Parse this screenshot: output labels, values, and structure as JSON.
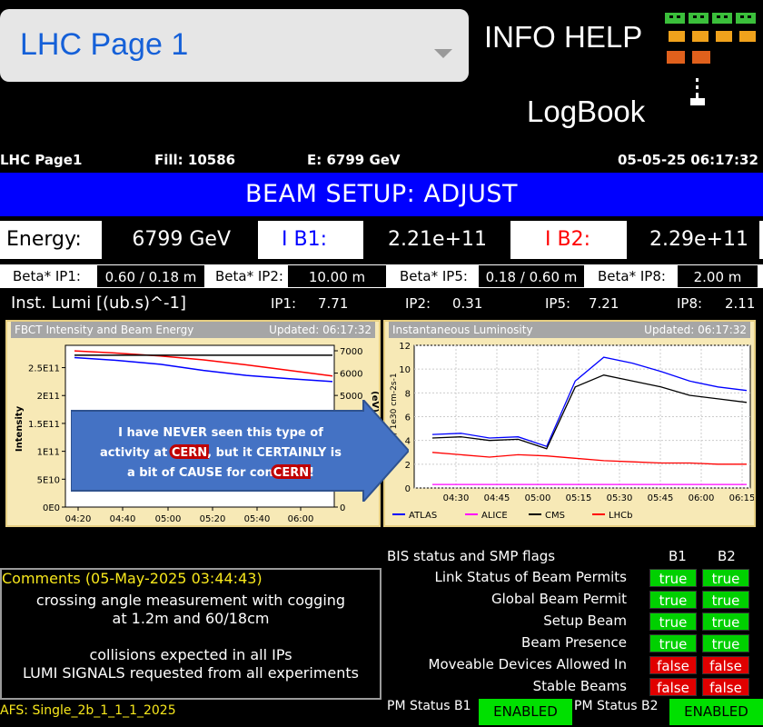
{
  "selector": {
    "label": "LHC Page 1"
  },
  "top_links": {
    "info_help": "INFO HELP",
    "logbook": "LogBook"
  },
  "status": {
    "page": "LHC Page1",
    "fill": "Fill: 10586",
    "energy": "E:  6799 GeV",
    "datetime": "05-05-25 06:17:32"
  },
  "banner": "BEAM SETUP: ADJUST",
  "energy_row": {
    "energy_label": "Energy:",
    "energy_value": "6799 GeV",
    "ib1_label": "I B1:",
    "ib1_value": "2.21e+11",
    "ib2_label": "I B2:",
    "ib2_value": "2.29e+11",
    "ib1_color": "#0000ff",
    "ib2_color": "#ff0000"
  },
  "beta": [
    {
      "label": "Beta* IP1:",
      "value": "0.60 / 0.18 m"
    },
    {
      "label": "Beta* IP2:",
      "value": "10.00 m"
    },
    {
      "label": "Beta* IP5:",
      "value": "0.18 / 0.60 m"
    },
    {
      "label": "Beta* IP8:",
      "value": "2.00 m"
    }
  ],
  "lumi": {
    "label": "Inst. Lumi [(ub.s)^-1]",
    "ip1": "IP1:",
    "ip1_v": "7.71",
    "ip2": "IP2:",
    "ip2_v": "0.31",
    "ip5": "IP5:",
    "ip5_v": "7.21",
    "ip8": "IP8:",
    "ip8_v": "2.11"
  },
  "left_panel": {
    "title": "FBCT Intensity and Beam Energy",
    "updated": "Updated: 06:17:32"
  },
  "right_panel": {
    "title": "Instantaneous Luminosity",
    "updated": "Updated: 06:17:32"
  },
  "chart_data": [
    {
      "type": "line",
      "title": "FBCT Intensity and Beam Energy",
      "ylabel": "Intensity",
      "y2label": "(eV)",
      "x": [
        "04:20",
        "04:40",
        "05:00",
        "05:20",
        "05:40",
        "06:00"
      ],
      "ylim": [
        0,
        290000000000.0
      ],
      "yticks": [
        "0E0",
        "5E10",
        "1E11",
        "1.5E11",
        "2E11",
        "2.5E11"
      ],
      "y2ticks": [
        "0",
        "1000",
        "2000",
        "3000",
        "4000",
        "5000",
        "6000",
        "7000"
      ],
      "series": [
        {
          "color": "#ff0000",
          "values": [
            280000000000.0,
            276000000000.0,
            271000000000.0,
            264000000000.0,
            255000000000.0,
            245000000000.0,
            235000000000.0
          ]
        },
        {
          "color": "#0000ff",
          "values": [
            268000000000.0,
            263000000000.0,
            256000000000.0,
            245000000000.0,
            236000000000.0,
            230000000000.0,
            225000000000.0
          ]
        },
        {
          "color": "#000000",
          "values": [
            6799,
            6799,
            6799,
            6799,
            6799,
            6799,
            6799
          ]
        }
      ]
    },
    {
      "type": "line",
      "title": "Instantaneous Luminosity",
      "ylabel": "Lu...y / 1e30 cm-2s-1",
      "x": [
        "04:30",
        "04:45",
        "05:00",
        "05:15",
        "05:30",
        "05:45",
        "06:00",
        "06:15"
      ],
      "ylim": [
        0,
        12
      ],
      "yticks": [
        "0",
        "2",
        "4",
        "6",
        "8",
        "10",
        "12"
      ],
      "legend": [
        "ATLAS",
        "ALICE",
        "CMS",
        "LHCb"
      ],
      "legend_colors": [
        "#0000ff",
        "#ff00ff",
        "#000000",
        "#ff0000"
      ],
      "series": [
        {
          "name": "ATLAS",
          "color": "#0000ff",
          "values": [
            4.5,
            4.6,
            4.2,
            4.3,
            3.5,
            9.0,
            11.0,
            10.5,
            9.8,
            9.0,
            8.5,
            8.2
          ]
        },
        {
          "name": "ALICE",
          "color": "#ff00ff",
          "values": [
            0.3,
            0.3,
            0.3,
            0.3,
            0.3,
            0.3,
            0.3,
            0.3,
            0.3,
            0.3,
            0.3,
            0.3
          ]
        },
        {
          "name": "CMS",
          "color": "#000000",
          "values": [
            4.2,
            4.3,
            4.0,
            4.1,
            3.3,
            8.5,
            9.5,
            9.0,
            8.5,
            7.8,
            7.5,
            7.2
          ]
        },
        {
          "name": "LHCb",
          "color": "#ff0000",
          "values": [
            3.0,
            2.8,
            2.6,
            2.8,
            2.7,
            2.5,
            2.3,
            2.2,
            2.1,
            2.1,
            2.0,
            2.0
          ]
        }
      ]
    }
  ],
  "callout": {
    "line1": "I have NEVER seen this type of",
    "line2a": "activity at ",
    "line2b": "CERN",
    "line2c": ", but it CERTAINLY is",
    "line3a": "a bit of CAUSE for con",
    "line3b": "CERN",
    "line3c": "!"
  },
  "comments": {
    "title": "Comments (05-May-2025 03:44:43)",
    "lines": [
      "crossing angle measurement with cogging",
      "at 1.2m and 60/18cm",
      "",
      "collisions expected in all IPs",
      "LUMI SIGNALS requested from all experiments"
    ]
  },
  "afs": "AFS: Single_2b_1_1_1_2025",
  "flags": {
    "title": "BIS status and SMP flags",
    "b1": "B1",
    "b2": "B2",
    "rows": [
      {
        "label": "Link Status of Beam Permits",
        "b1": "true",
        "b2": "true"
      },
      {
        "label": "Global Beam Permit",
        "b1": "true",
        "b2": "true"
      },
      {
        "label": "Setup Beam",
        "b1": "true",
        "b2": "true"
      },
      {
        "label": "Beam Presence",
        "b1": "true",
        "b2": "true"
      },
      {
        "label": "Moveable Devices Allowed In",
        "b1": "false",
        "b2": "false"
      },
      {
        "label": "Stable Beams",
        "b1": "false",
        "b2": "false"
      }
    ]
  },
  "pm": {
    "b1_label": "PM Status B1",
    "b1_value": "ENABLED",
    "b2_label": "PM Status B2",
    "b2_value": "ENABLED"
  }
}
